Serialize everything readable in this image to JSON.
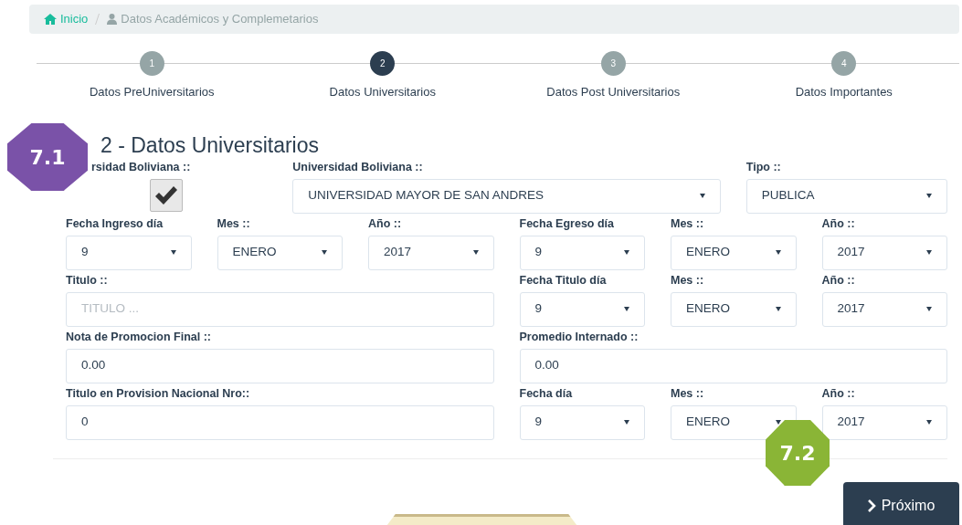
{
  "breadcrumb": [
    {
      "kind": "link",
      "label": "Inicio"
    },
    {
      "kind": "current",
      "label": "Datos Académicos y Complemetarios"
    }
  ],
  "steps": [
    {
      "number": "1",
      "label": "Datos PreUniversitarios",
      "selected": false
    },
    {
      "number": "2",
      "label": "Datos Universitarios",
      "selected": true
    },
    {
      "number": "3",
      "label": "Datos Post Universitarios",
      "selected": false
    },
    {
      "number": "4",
      "label": "Datos Importantes",
      "selected": false
    }
  ],
  "section_title": "2 - Datos Universitarios",
  "form_rows": [
    [
      {
        "kind": "checkbox",
        "label": "rsidad Boliviana ::",
        "checked": true
      },
      {
        "kind": "select",
        "label": "Universidad Boliviana ::",
        "value": "UNIVERSIDAD MAYOR DE SAN ANDRES"
      },
      {
        "kind": "select",
        "label": "Tipo ::",
        "value": "PUBLICA"
      }
    ],
    [
      {
        "kind": "select",
        "label": "Fecha Ingreso día",
        "value": "9"
      },
      {
        "kind": "select",
        "label": "Mes ::",
        "value": "ENERO"
      },
      {
        "kind": "select",
        "label": "Año ::",
        "value": "2017"
      },
      {
        "kind": "select",
        "label": "Fecha Egreso día",
        "value": "9"
      },
      {
        "kind": "select",
        "label": "Mes ::",
        "value": "ENERO"
      },
      {
        "kind": "select",
        "label": "Año ::",
        "value": "2017"
      }
    ],
    [
      {
        "kind": "input",
        "label": "Titulo ::",
        "placeholder": "TITULO ..."
      },
      {
        "kind": "select",
        "label": "Fecha Titulo día",
        "value": "9"
      },
      {
        "kind": "select",
        "label": "Mes ::",
        "value": "ENERO"
      },
      {
        "kind": "select",
        "label": "Año ::",
        "value": "2017"
      }
    ],
    [
      {
        "kind": "input",
        "label": "Nota de Promocion Final ::",
        "value": "0.00"
      },
      {
        "kind": "input",
        "label": "Promedio Internado ::",
        "value": "0.00"
      }
    ],
    [
      {
        "kind": "input",
        "label": "Titulo en Provision Nacional Nro::",
        "value": "0"
      },
      {
        "kind": "select",
        "label": "Fecha día",
        "value": "9"
      },
      {
        "kind": "select",
        "label": "Mes ::",
        "value": "ENERO"
      },
      {
        "kind": "select",
        "label": "Año ::",
        "value": "2017"
      }
    ]
  ],
  "next_button": {
    "label": "Próximo"
  },
  "annotations": [
    {
      "kind": "octagon",
      "label": "7.1",
      "color": "#7a52a8"
    },
    {
      "kind": "octagon",
      "label": "7.2",
      "color": "#8ab536"
    },
    {
      "kind": "plaque",
      "color": "#f4ebc8"
    }
  ]
}
